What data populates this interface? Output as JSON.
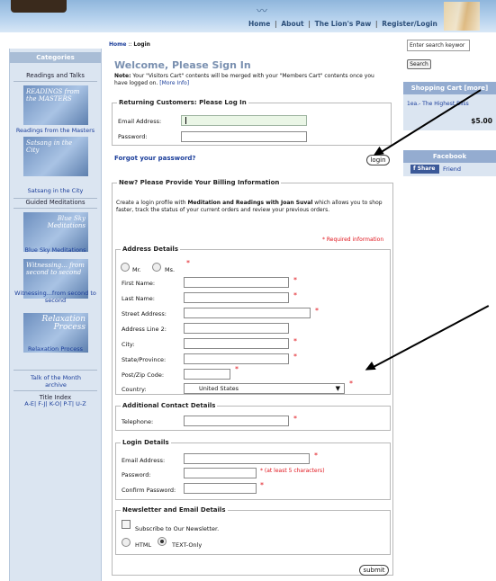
{
  "header": {
    "nav": [
      "Home",
      "About",
      "The Lion's Paw",
      "Register/Login"
    ],
    "separator": "|"
  },
  "sidebar": {
    "categories_title": "Categories",
    "readings_and_talks": "Readings and Talks",
    "items": [
      {
        "image_text": "READINGS from the MASTERS",
        "label": "Readings from the Masters"
      },
      {
        "image_text": "Satsang in the City",
        "label": "Satsang in the City"
      }
    ],
    "guided_meditations": "Guided Meditations",
    "meditations": [
      {
        "image_text": "Blue Sky Meditations",
        "label": "Blue Sky Meditations"
      },
      {
        "image_text": "Witnessing... from second to second",
        "label": "Witnessing...from second to second"
      },
      {
        "image_text": "Relaxation Process",
        "label": "Relaxation Process"
      }
    ],
    "talk_of_month": "Talk of the Month archive",
    "title_index": "Title Index",
    "title_index_links": "A-E| F-J| K-O| P-T| U-Z"
  },
  "breadcrumb": {
    "home": "Home",
    "sep": "::",
    "current": "Login"
  },
  "main": {
    "welcome": "Welcome, Please Sign In",
    "note_label": "Note:",
    "note_text": "Your \"Visitors Cart\" contents will be merged with your \"Members Cart\" contents once you have logged on.",
    "note_link": "[More Info]",
    "returning": {
      "legend": "Returning Customers: Please Log In",
      "email_label": "Email Address:",
      "password_label": "Password:"
    },
    "forgot_password": "Forgot your password?",
    "login_button": "login",
    "new_customer": {
      "legend": "New? Please Provide Your Billing Information",
      "intro_before": "Create a login profile with ",
      "intro_bold": "Meditation and Readings with Joan Suval",
      "intro_after": " which allows you to shop faster, track the status of your current orders and review your previous orders.",
      "required_info": "* Required information"
    },
    "address": {
      "legend": "Address Details",
      "mr": "Mr.",
      "ms": "Ms.",
      "first_name": "First Name:",
      "last_name": "Last Name:",
      "street": "Street Address:",
      "address2": "Address Line 2:",
      "city": "City:",
      "state": "State/Province:",
      "postcode": "Post/Zip Code:",
      "country": "Country:",
      "country_value": "United States"
    },
    "contact": {
      "legend": "Additional Contact Details",
      "telephone": "Telephone:"
    },
    "login_details": {
      "legend": "Login Details",
      "email": "Email Address:",
      "password": "Password:",
      "password_hint": "* (at least 5 characters)",
      "confirm": "Confirm Password:"
    },
    "newsletter": {
      "legend": "Newsletter and Email Details",
      "subscribe": "Subscribe to Our Newsletter.",
      "html": "HTML",
      "text_only": "TEXT-Only"
    },
    "submit_button": "submit",
    "required_mark": "*"
  },
  "right": {
    "search_placeholder": "Enter search keywor",
    "search_button": "Search",
    "cart_title": "Shopping Cart [more]",
    "cart_item": "1ea.- The Highest Bliss",
    "cart_total": "$5.00",
    "facebook_title": "Facebook",
    "share": "Share",
    "friend": "Friend"
  }
}
